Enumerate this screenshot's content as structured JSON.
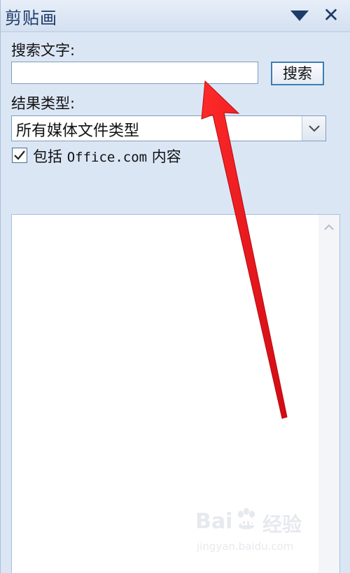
{
  "pane": {
    "title": "剪贴画",
    "menu_icon": "dropdown-triangle-icon",
    "close_icon": "close-icon",
    "close_glyph": "✕"
  },
  "search": {
    "label": "搜索文字:",
    "value": "",
    "placeholder": "",
    "button_label": "搜索"
  },
  "results_type": {
    "label": "结果类型:",
    "selected": "所有媒体文件类型"
  },
  "include_office": {
    "checked": true,
    "label_prefix": "包括 ",
    "label_domain": "Office.com",
    "label_suffix": " 内容"
  },
  "watermark": {
    "brand_left": "Bai",
    "brand_right": "du",
    "brand_cn": "经验",
    "url": "jingyan.baidu.com"
  },
  "colors": {
    "pane_bg": "#dbe6f5",
    "title_text": "#1e3c68",
    "button_border": "#3c7fb1",
    "annotation_arrow": "#e8141c"
  }
}
